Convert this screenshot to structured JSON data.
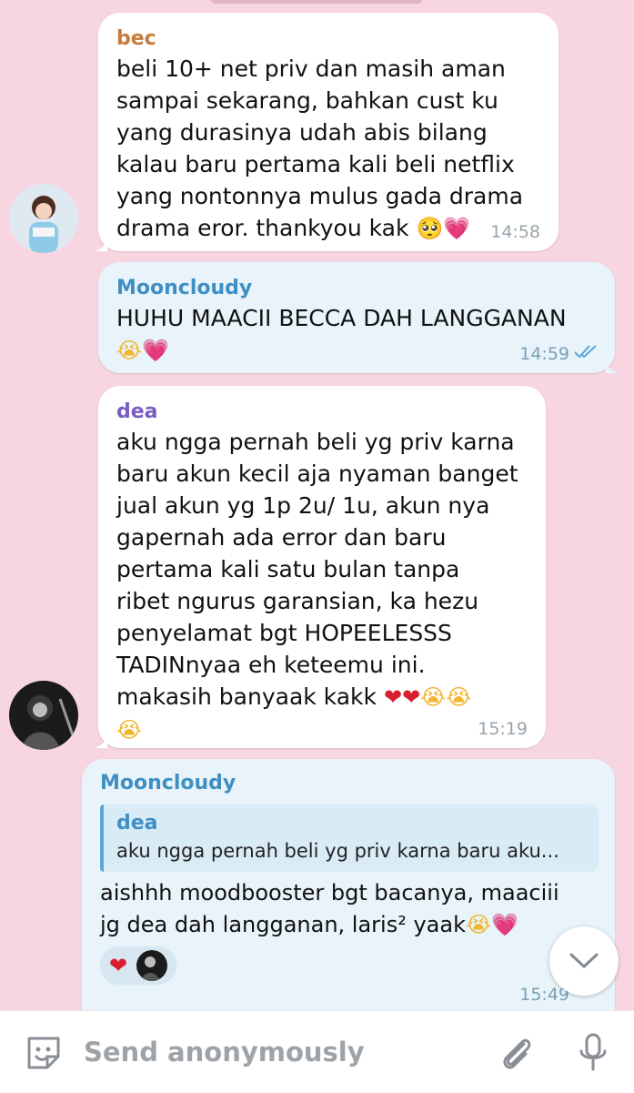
{
  "messages": [
    {
      "sender": "bec",
      "sender_color": "#c77c3c",
      "lines": [
        "beli 10+ net priv dan masih aman",
        "sampai sekarang, bahkan cust ku",
        "yang durasinya udah abis bilang",
        "kalau baru pertama kali beli netflix",
        "yang nontonnya mulus gada drama",
        "drama eror. thankyou kak"
      ],
      "time": "14:58"
    },
    {
      "sender": "Mooncloudy",
      "sender_color": "#3f8fc4",
      "lines": [
        "HUHU MAACII BECCA DAH LANGGANAN"
      ],
      "time": "14:59"
    },
    {
      "sender": "dea",
      "sender_color": "#7a5cc4",
      "lines": [
        "aku ngga pernah beli yg priv karna",
        "baru akun kecil aja nyaman banget",
        "jual akun yg 1p 2u/ 1u, akun nya",
        "gapernah ada error dan baru",
        "pertama kali satu bulan tanpa",
        "ribet ngurus garansian, ka hezu",
        "penyelamat bgt HOPEELESSS",
        "TADINnyaa eh keteemu ini.",
        "makasih banyaak kakk"
      ],
      "time": "15:19"
    },
    {
      "sender": "Mooncloudy",
      "sender_color": "#3f8fc4",
      "quote_name": "dea",
      "quote_text": "aku ngga pernah beli yg priv karna baru aku...",
      "lines": [
        "aishhh moodbooster bgt bacanya, maaciii",
        "jg dea dah langganan, laris² yaak"
      ],
      "time": "15:49"
    }
  ],
  "composer": {
    "placeholder": "Send anonymously"
  },
  "icons": {
    "sticker": "sticker-icon",
    "attach": "paperclip-icon",
    "mic": "microphone-icon",
    "scroll": "chevron-down-icon"
  }
}
